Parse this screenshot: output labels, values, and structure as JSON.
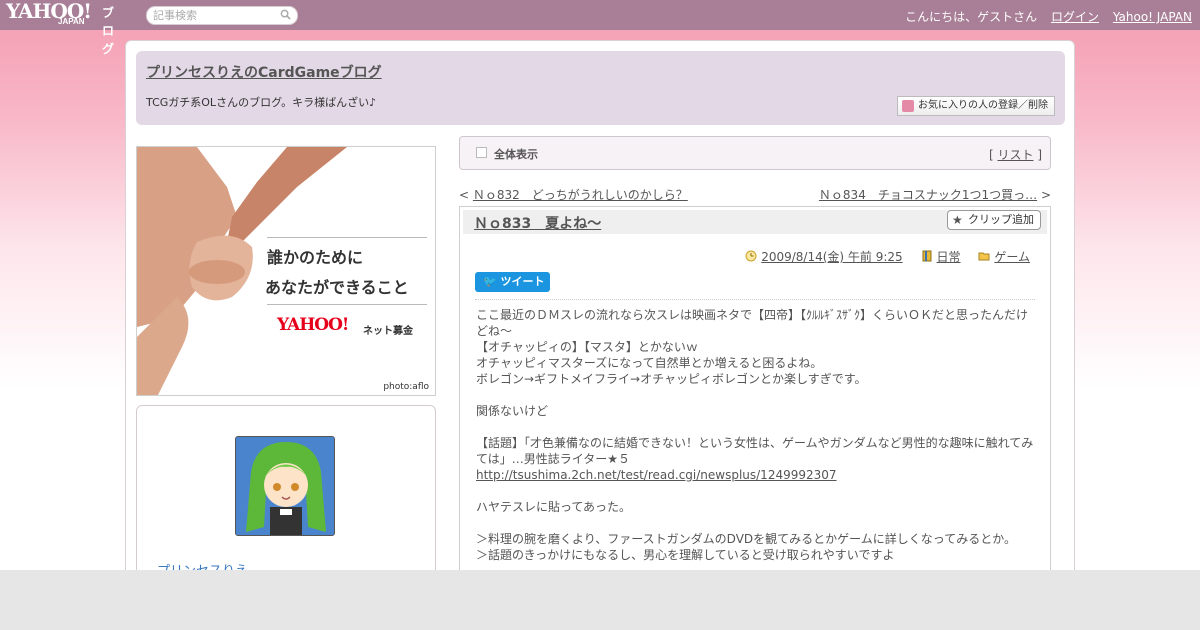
{
  "topbar": {
    "logo": "YAHOO!",
    "logo_sub": "JAPAN",
    "logo_blog": "ブログ",
    "search_placeholder": "記事検索",
    "greeting": "こんにちは、ゲストさん",
    "login": "ログイン",
    "yahoo_japan": "Yahoo! JAPAN"
  },
  "header": {
    "title": "プリンセスりえのCardGameブログ",
    "description": "TCGガチ系OLさんのブログ。キラ様ばんざい♪",
    "fav_button": "お気に入りの人の登録／削除"
  },
  "banner": {
    "line1": "誰かのために",
    "line2": "あなたができること",
    "logo": "YAHOO!",
    "logo_sub": "JAPAN",
    "tagline": "ネット募金",
    "credit": "photo:aflo"
  },
  "profile": {
    "name": "プリンセスりえ"
  },
  "category": {
    "label": "全体表示",
    "list_open": "[",
    "list": "リスト",
    "list_close": "]"
  },
  "nav": {
    "prev_mark": "<",
    "prev": "Ｎｏ832　どっちがうれしいのかしら？",
    "next": "Ｎｏ834　チョコスナック1つ1つ買っ…",
    "next_mark": ">"
  },
  "article": {
    "title": "Ｎｏ833　夏よね～",
    "clip_button": "クリップ追加",
    "date": "2009/8/14(金) 午前 9:25",
    "category1": "日常",
    "category2": "ゲーム",
    "tweet": "ツイート",
    "paragraphs": [
      "ここ最近のＤＭスレの流れなら次スレは映画ネタで【四帝】【ｸﾙﾙｷﾞｽｻﾞｸ】くらいＯＫだと思ったんだけどね～\n【オチャッピィの】【マスタ】とかないｗ\nオチャッピィマスターズになって自然単とか増えると困るよね。\nボレゴン→ギフトメイフライ→オチャッピィボレゴンとか楽しすぎです。",
      "関係ないけど",
      "【話題】「才色兼備なのに結婚できない！という女性は、ゲームやガンダムなど男性的な趣味に触れてみては」…男性誌ライター★５"
    ],
    "link": "http://tsushima.2ch.net/test/read.cgi/newsplus/1249992307",
    "paragraph_after_link": "ハヤテスレに貼ってあった。",
    "quote1": "＞料理の腕を磨くより、ファーストガンダムのDVDを観てみるとかゲームに詳しくなってみるとか。",
    "quote2": "＞話題のきっかけにもなるし、男心を理解していると受け取られやすいですよ"
  },
  "colors": {
    "topbar": "#a87f96",
    "header_bg": "#e3d8e6",
    "tweet": "#1b95e0"
  }
}
